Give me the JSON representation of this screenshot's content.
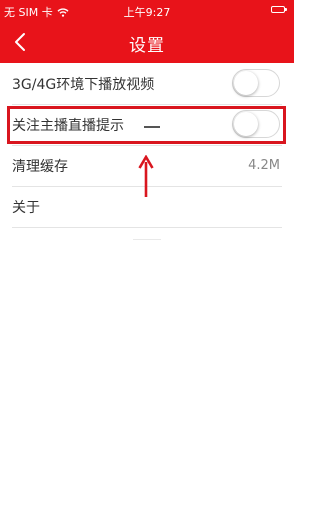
{
  "status_bar": {
    "carrier": "无 SIM 卡",
    "time": "上午9:27"
  },
  "nav": {
    "title": "设置",
    "back_icon": "chevron-left-icon"
  },
  "settings": [
    {
      "label": "3G/4G环境下播放视频",
      "toggle_on": false
    },
    {
      "label": "关注主播直播提示",
      "toggle_on": false
    },
    {
      "label": "清理缓存",
      "value": "4.2M"
    },
    {
      "label": "关于"
    }
  ],
  "annotation": {
    "color": "#d9161f"
  },
  "colors": {
    "accent": "#e8131a",
    "toggle_off_border": "#d7d7d7"
  }
}
